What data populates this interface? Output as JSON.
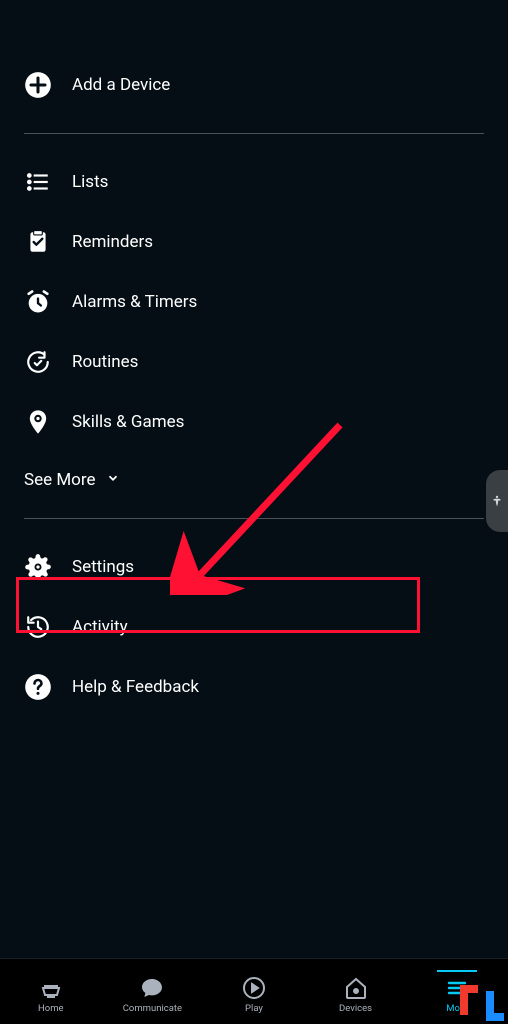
{
  "menu": {
    "add_device": "Add a Device",
    "lists": "Lists",
    "reminders": "Reminders",
    "alarms_timers": "Alarms & Timers",
    "routines": "Routines",
    "skills_games": "Skills & Games",
    "see_more": "See More",
    "settings": "Settings",
    "activity": "Activity",
    "help_feedback": "Help & Feedback"
  },
  "nav": {
    "home": "Home",
    "communicate": "Communicate",
    "play": "Play",
    "devices": "Devices",
    "more": "More"
  },
  "annotation": {
    "highlight_target": "settings"
  }
}
